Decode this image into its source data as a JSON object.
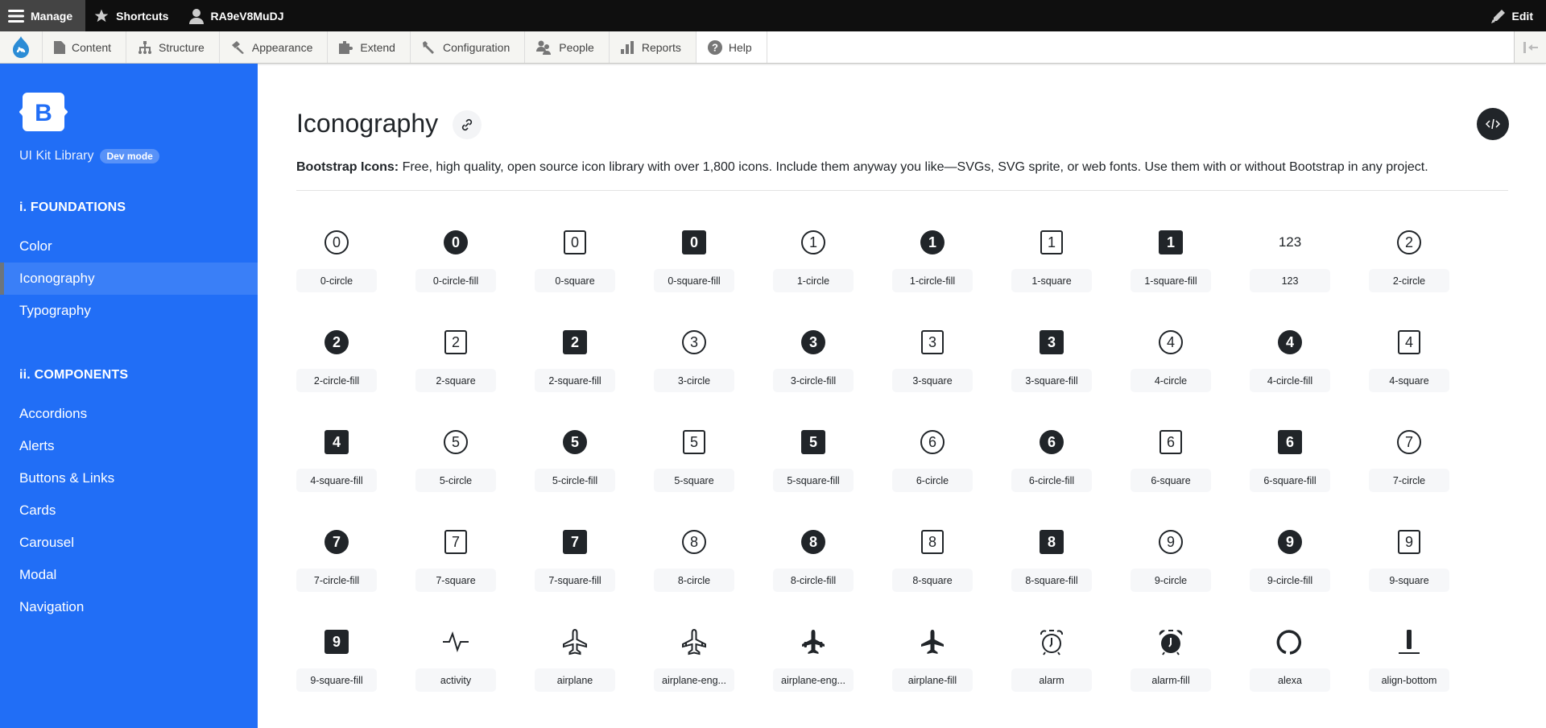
{
  "admin_bar": {
    "manage": "Manage",
    "shortcuts": "Shortcuts",
    "user": "RA9eV8MuDJ",
    "edit": "Edit"
  },
  "toolbar": {
    "items": [
      {
        "label": "Content",
        "icon": "file-icon"
      },
      {
        "label": "Structure",
        "icon": "structure-icon"
      },
      {
        "label": "Appearance",
        "icon": "brush-icon"
      },
      {
        "label": "Extend",
        "icon": "puzzle-icon"
      },
      {
        "label": "Configuration",
        "icon": "wrench-icon"
      },
      {
        "label": "People",
        "icon": "people-icon"
      },
      {
        "label": "Reports",
        "icon": "bar-chart-icon"
      },
      {
        "label": "Help",
        "icon": "help-icon"
      }
    ]
  },
  "sidebar": {
    "brand_letter": "B",
    "brand_name": "UI Kit Library",
    "badge": "Dev mode",
    "sections": [
      {
        "title": "i. FOUNDATIONS",
        "items": [
          "Color",
          "Iconography",
          "Typography"
        ],
        "active": "Iconography"
      },
      {
        "title": "ii. COMPONENTS",
        "items": [
          "Accordions",
          "Alerts",
          "Buttons & Links",
          "Cards",
          "Carousel",
          "Modal",
          "Navigation"
        ]
      }
    ]
  },
  "main": {
    "title": "Iconography",
    "description_bold": "Bootstrap Icons:",
    "description": " Free, high quality, open source icon library with over 1,800 icons. Include them anyway you like—SVGs, SVG sprite, or web fonts. Use them with or without Bootstrap in any project.",
    "icons": [
      {
        "name": "0-circle",
        "glyph": "0",
        "style": "o-c"
      },
      {
        "name": "0-circle-fill",
        "glyph": "0",
        "style": "f-c"
      },
      {
        "name": "0-square",
        "glyph": "0",
        "style": "o-s"
      },
      {
        "name": "0-square-fill",
        "glyph": "0",
        "style": "f-s"
      },
      {
        "name": "1-circle",
        "glyph": "1",
        "style": "o-c"
      },
      {
        "name": "1-circle-fill",
        "glyph": "1",
        "style": "f-c"
      },
      {
        "name": "1-square",
        "glyph": "1",
        "style": "o-s"
      },
      {
        "name": "1-square-fill",
        "glyph": "1",
        "style": "f-s"
      },
      {
        "name": "123",
        "glyph": "123",
        "style": "plain"
      },
      {
        "name": "2-circle",
        "glyph": "2",
        "style": "o-c"
      },
      {
        "name": "2-circle-fill",
        "glyph": "2",
        "style": "f-c"
      },
      {
        "name": "2-square",
        "glyph": "2",
        "style": "o-s"
      },
      {
        "name": "2-square-fill",
        "glyph": "2",
        "style": "f-s"
      },
      {
        "name": "3-circle",
        "glyph": "3",
        "style": "o-c"
      },
      {
        "name": "3-circle-fill",
        "glyph": "3",
        "style": "f-c"
      },
      {
        "name": "3-square",
        "glyph": "3",
        "style": "o-s"
      },
      {
        "name": "3-square-fill",
        "glyph": "3",
        "style": "f-s"
      },
      {
        "name": "4-circle",
        "glyph": "4",
        "style": "o-c"
      },
      {
        "name": "4-circle-fill",
        "glyph": "4",
        "style": "f-c"
      },
      {
        "name": "4-square",
        "glyph": "4",
        "style": "o-s"
      },
      {
        "name": "4-square-fill",
        "glyph": "4",
        "style": "f-s"
      },
      {
        "name": "5-circle",
        "glyph": "5",
        "style": "o-c"
      },
      {
        "name": "5-circle-fill",
        "glyph": "5",
        "style": "f-c"
      },
      {
        "name": "5-square",
        "glyph": "5",
        "style": "o-s"
      },
      {
        "name": "5-square-fill",
        "glyph": "5",
        "style": "f-s"
      },
      {
        "name": "6-circle",
        "glyph": "6",
        "style": "o-c"
      },
      {
        "name": "6-circle-fill",
        "glyph": "6",
        "style": "f-c"
      },
      {
        "name": "6-square",
        "glyph": "6",
        "style": "o-s"
      },
      {
        "name": "6-square-fill",
        "glyph": "6",
        "style": "f-s"
      },
      {
        "name": "7-circle",
        "glyph": "7",
        "style": "o-c"
      },
      {
        "name": "7-circle-fill",
        "glyph": "7",
        "style": "f-c"
      },
      {
        "name": "7-square",
        "glyph": "7",
        "style": "o-s"
      },
      {
        "name": "7-square-fill",
        "glyph": "7",
        "style": "f-s"
      },
      {
        "name": "8-circle",
        "glyph": "8",
        "style": "o-c"
      },
      {
        "name": "8-circle-fill",
        "glyph": "8",
        "style": "f-c"
      },
      {
        "name": "8-square",
        "glyph": "8",
        "style": "o-s"
      },
      {
        "name": "8-square-fill",
        "glyph": "8",
        "style": "f-s"
      },
      {
        "name": "9-circle",
        "glyph": "9",
        "style": "o-c"
      },
      {
        "name": "9-circle-fill",
        "glyph": "9",
        "style": "f-c"
      },
      {
        "name": "9-square",
        "glyph": "9",
        "style": "o-s"
      },
      {
        "name": "9-square-fill",
        "glyph": "9",
        "style": "f-s"
      },
      {
        "name": "activity",
        "label": "activity",
        "style": "svg",
        "svg": "activity"
      },
      {
        "name": "airplane",
        "label": "airplane",
        "style": "svg",
        "svg": "airplane"
      },
      {
        "name": "airplane-engines",
        "label": "airplane-eng...",
        "style": "svg",
        "svg": "airplane-engines"
      },
      {
        "name": "airplane-engines-fill",
        "label": "airplane-eng...",
        "style": "svg",
        "svg": "airplane-engines-fill"
      },
      {
        "name": "airplane-fill",
        "label": "airplane-fill",
        "style": "svg",
        "svg": "airplane-fill"
      },
      {
        "name": "alarm",
        "label": "alarm",
        "style": "svg",
        "svg": "alarm"
      },
      {
        "name": "alarm-fill",
        "label": "alarm-fill",
        "style": "svg",
        "svg": "alarm-fill"
      },
      {
        "name": "alexa",
        "label": "alexa",
        "style": "svg",
        "svg": "alexa"
      },
      {
        "name": "align-bottom",
        "label": "align-bottom",
        "style": "svg",
        "svg": "align-bottom"
      }
    ]
  }
}
